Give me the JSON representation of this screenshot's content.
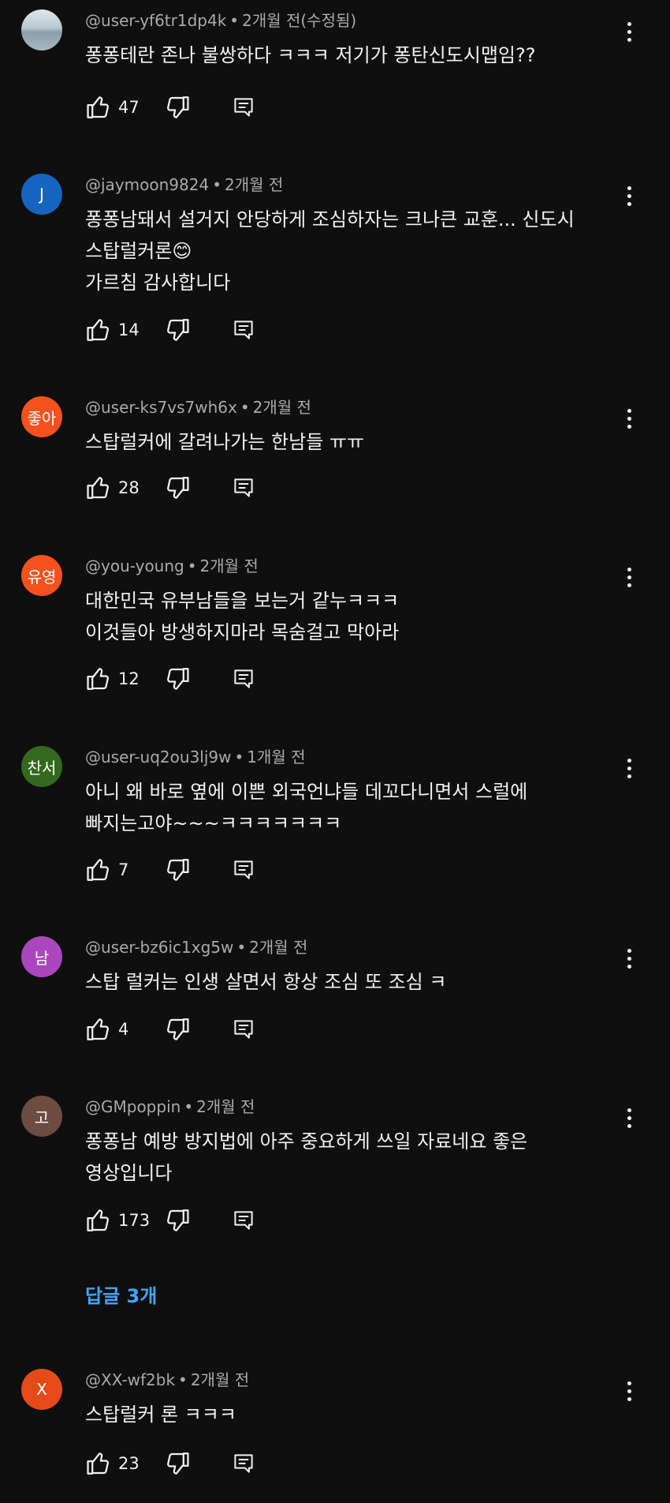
{
  "comments": [
    {
      "author": "@user-yf6tr1dp4k",
      "time": "2개월 전(수정됨)",
      "text": "퐁퐁테란 존나 불쌍하다 ㅋㅋㅋ  저기가 퐁탄신도시맵임??",
      "likes": "47",
      "avatar_letter": "",
      "avatar_color": "#9fb3bf"
    },
    {
      "author": "@jaymoon9824",
      "time": "2개월 전",
      "text": "퐁퐁남돼서 설거지 안당하게 조심하자는 크나큰 교훈... 신도시\n스탑럴커론😊\n가르침 감사합니다",
      "likes": "14",
      "avatar_letter": "J",
      "avatar_color": "#1565c0"
    },
    {
      "author": "@user-ks7vs7wh6x",
      "time": "2개월 전",
      "text": "스탑럴커에 갈려나가는 한남들 ㅠㅠ",
      "likes": "28",
      "avatar_letter": "좋아",
      "avatar_color": "#f4511e"
    },
    {
      "author": "@you-young",
      "time": "2개월 전",
      "text": "대한민국 유부남들을 보는거 같누ㅋㅋㅋ\n이것들아 방생하지마라 목숨걸고 막아라",
      "likes": "12",
      "avatar_letter": "유영",
      "avatar_color": "#f4511e"
    },
    {
      "author": "@user-uq2ou3lj9w",
      "time": "1개월 전",
      "text": "아니 왜 바로 옆에 이쁜 외국언냐들 데꼬다니면서 스럴에\n빠지는고야~~~ㅋㅋㅋㅋㅋㅋㅋ",
      "likes": "7",
      "avatar_letter": "찬서",
      "avatar_color": "#33691e"
    },
    {
      "author": "@user-bz6ic1xg5w",
      "time": "2개월 전",
      "text": "스탑 럴커는 인생 살면서 항상 조심 또 조심 ㅋ",
      "likes": "4",
      "avatar_letter": "남",
      "avatar_color": "#ab47bc"
    },
    {
      "author": "@GMpoppin",
      "time": "2개월 전",
      "text": "퐁퐁남 예방 방지법에 아주 중요하게 쓰일 자료네요 좋은\n영상입니다",
      "likes": "173",
      "avatar_letter": "고",
      "avatar_color": "#6d4c41",
      "replies_label": "답글 3개"
    },
    {
      "author": "@XX-wf2bk",
      "time": "2개월 전",
      "text": "스탑럴커 론 ㅋㅋㅋ",
      "likes": "23",
      "avatar_letter": "X",
      "avatar_color": "#e64a19"
    }
  ],
  "colors": {
    "background": "#0f0f0f",
    "meta": "#aaaaaa",
    "link": "#3ea6ff"
  },
  "icons": {
    "like": "thumbs-up-icon",
    "dislike": "thumbs-down-icon",
    "reply": "reply-icon",
    "more": "more-vert-icon"
  }
}
